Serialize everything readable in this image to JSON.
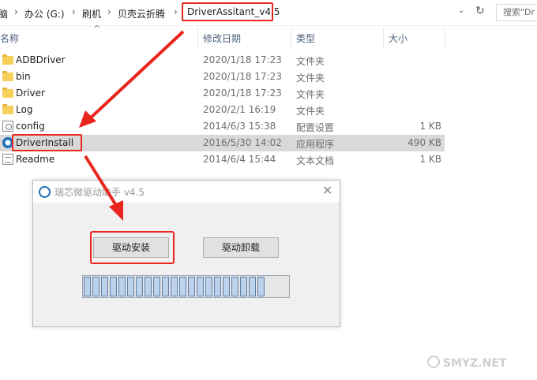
{
  "address_bar": {
    "crumbs": [
      "脑",
      "办公 (G:)",
      "刷机",
      "贝壳云折腾"
    ],
    "current": "DriverAssitant_v4.5",
    "search_placeholder": "搜索\"Dr"
  },
  "columns": {
    "name": "名称",
    "date": "修改日期",
    "type": "类型",
    "size": "大小"
  },
  "files": [
    {
      "name": "ADBDriver",
      "date": "2020/1/18 17:23",
      "type": "文件夹",
      "size": "",
      "icon": "folder-icon"
    },
    {
      "name": "bin",
      "date": "2020/1/18 17:23",
      "type": "文件夹",
      "size": "",
      "icon": "folder-icon"
    },
    {
      "name": "Driver",
      "date": "2020/1/18 17:23",
      "type": "文件夹",
      "size": "",
      "icon": "folder-icon"
    },
    {
      "name": "Log",
      "date": "2020/2/1 16:19",
      "type": "文件夹",
      "size": "",
      "icon": "folder-icon"
    },
    {
      "name": "config",
      "date": "2014/6/3 15:38",
      "type": "配置设置",
      "size": "1 KB",
      "icon": "config-file-icon"
    },
    {
      "name": "DriverInstall",
      "date": "2016/5/30 14:02",
      "type": "应用程序",
      "size": "490 KB",
      "icon": "application-icon"
    },
    {
      "name": "Readme",
      "date": "2014/6/4 15:44",
      "type": "文本文档",
      "size": "1 KB",
      "icon": "text-document-icon"
    }
  ],
  "dialog": {
    "title": "瑞芯微驱动助手 v4.5",
    "install_button": "驱动安装",
    "uninstall_button": "驱动卸载",
    "progress_segments": 21,
    "close_glyph": "✕"
  },
  "watermark": "SMYZ.NET",
  "colors": {
    "annotation_red": "#e8261f",
    "selected_row": "#d9d9d9",
    "progress_fill": "#bcd1ea"
  }
}
